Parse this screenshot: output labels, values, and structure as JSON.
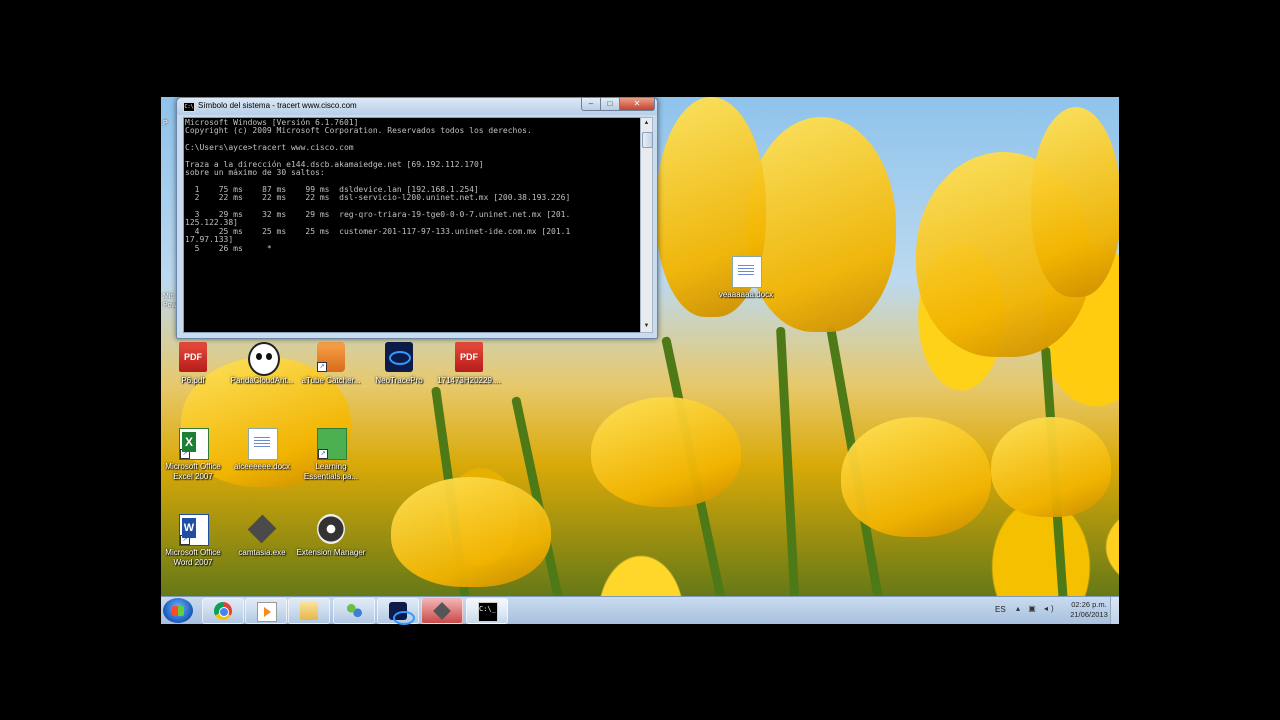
{
  "window": {
    "title": "Símbolo del sistema - tracert  www.cisco.com",
    "icon_glyph": "C:\\",
    "buttons": {
      "minimize": "–",
      "maximize": "□",
      "close": "✕"
    },
    "console_lines": [
      "Microsoft Windows [Versión 6.1.7601]",
      "Copyright (c) 2009 Microsoft Corporation. Reservados todos los derechos.",
      "",
      "C:\\Users\\ayce>tracert www.cisco.com",
      "",
      "Traza a la dirección e144.dscb.akamaiedge.net [69.192.112.170]",
      "sobre un máximo de 30 saltos:",
      "",
      "  1    75 ms    87 ms    99 ms  dsldevice.lan [192.168.1.254]",
      "  2    22 ms    22 ms    22 ms  dsl-servicio-l200.uninet.net.mx [200.38.193.226]",
      "",
      "  3    29 ms    32 ms    29 ms  reg-qro-triara-19-tge0-0-0-7.uninet.net.mx [201.",
      "125.122.38]",
      "  4    25 ms    25 ms    25 ms  customer-201-117-97-133.uninet-ide.com.mx [201.1",
      "17.97.133]",
      "  5    26 ms     *"
    ]
  },
  "desktop": {
    "icons": [
      {
        "label": "P6.pdf",
        "icon": "pdf-icon"
      },
      {
        "label": "PandaCloudAnt...",
        "icon": "panda-icon"
      },
      {
        "label": "aTube Catcher...",
        "icon": "atube-catcher-icon"
      },
      {
        "label": "NeoTracePro",
        "icon": "neotrace-icon"
      },
      {
        "label": "171473H20229....",
        "icon": "pdf-icon"
      },
      {
        "label": "Microsoft Office Excel 2007",
        "icon": "excel-icon"
      },
      {
        "label": "aiceeeeee.docx",
        "icon": "docx-icon"
      },
      {
        "label": "Learning Essentials.pa...",
        "icon": "learning-essentials-icon"
      },
      {
        "label": "Microsoft Office Word 2007",
        "icon": "word-icon"
      },
      {
        "label": "camtasia.exe",
        "icon": "camtasia-icon"
      },
      {
        "label": "Extension Manager",
        "icon": "extension-manager-icon"
      },
      {
        "label": "veaaaaaa.docx",
        "icon": "docx-icon"
      }
    ],
    "pdf_badge": "PDF",
    "partial_left_labels": [
      "Mic",
      "Pow"
    ],
    "partial_left_top": "P"
  },
  "taskbar": {
    "language": "ES",
    "tray_icons": [
      "show-hidden-icon",
      "network-icon",
      "volume-icon"
    ],
    "tray_glyphs": "▴ ▣ ◂)",
    "time": "02:26 p.m.",
    "date": "21/06/2013",
    "cmd_glyph": "C:\\_"
  },
  "colors": {
    "console_bg": "#000000",
    "console_text": "#c0c0c0",
    "close_red": "#c6422a"
  }
}
